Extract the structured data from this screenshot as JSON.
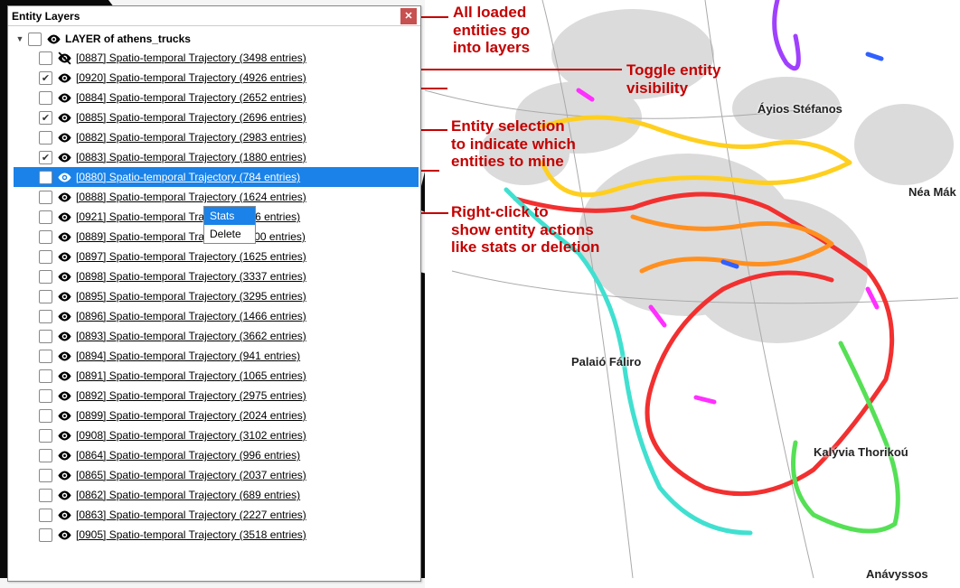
{
  "panel": {
    "title": "Entity Layers",
    "layer_label": "LAYER of athens_trucks",
    "context_menu": {
      "stats": "Stats",
      "delete": "Delete"
    },
    "entities": [
      {
        "id": "0887",
        "count": 3498,
        "checked": false,
        "visible": false
      },
      {
        "id": "0920",
        "count": 4926,
        "checked": true,
        "visible": true
      },
      {
        "id": "0884",
        "count": 2652,
        "checked": false,
        "visible": true
      },
      {
        "id": "0885",
        "count": 2696,
        "checked": true,
        "visible": true
      },
      {
        "id": "0882",
        "count": 2983,
        "checked": false,
        "visible": true
      },
      {
        "id": "0883",
        "count": 1880,
        "checked": true,
        "visible": true
      },
      {
        "id": "0880",
        "count": 784,
        "checked": false,
        "visible": true,
        "selected": true
      },
      {
        "id": "0888",
        "count": 1624,
        "checked": false,
        "visible": true
      },
      {
        "id": "0921",
        "count": 576,
        "checked": false,
        "visible": true
      },
      {
        "id": "0889",
        "count": 1100,
        "checked": false,
        "visible": true
      },
      {
        "id": "0897",
        "count": 1625,
        "checked": false,
        "visible": true
      },
      {
        "id": "0898",
        "count": 3337,
        "checked": false,
        "visible": true
      },
      {
        "id": "0895",
        "count": 3295,
        "checked": false,
        "visible": true
      },
      {
        "id": "0896",
        "count": 1466,
        "checked": false,
        "visible": true
      },
      {
        "id": "0893",
        "count": 3662,
        "checked": false,
        "visible": true
      },
      {
        "id": "0894",
        "count": 941,
        "checked": false,
        "visible": true
      },
      {
        "id": "0891",
        "count": 1065,
        "checked": false,
        "visible": true
      },
      {
        "id": "0892",
        "count": 2975,
        "checked": false,
        "visible": true
      },
      {
        "id": "0899",
        "count": 2024,
        "checked": false,
        "visible": true
      },
      {
        "id": "0908",
        "count": 3102,
        "checked": false,
        "visible": true
      },
      {
        "id": "0864",
        "count": 996,
        "checked": false,
        "visible": true
      },
      {
        "id": "0865",
        "count": 2037,
        "checked": false,
        "visible": true
      },
      {
        "id": "0862",
        "count": 689,
        "checked": false,
        "visible": true
      },
      {
        "id": "0863",
        "count": 2227,
        "checked": false,
        "visible": true
      },
      {
        "id": "0905",
        "count": 3518,
        "checked": false,
        "visible": true
      }
    ]
  },
  "annotations": {
    "a1": "All loaded\nentities go\ninto layers",
    "a2": "Toggle entity\nvisibility",
    "a3": "Entity selection\nto indicate which\nentities to mine",
    "a4": "Right-click to\nshow entity actions\nlike stats or deletion"
  },
  "map_labels": {
    "ayios_stefanos": "Áyios Stéfanos",
    "nea_maki": "Néa Mák",
    "palaio_faliro": "Palaió Fáliro",
    "kalyvia": "Kalývia Thorikoú",
    "anavyssos": "Anávyssos"
  },
  "colors": {
    "selection": "#1a82e8",
    "annotation": "#c40000",
    "close": "#c75050"
  }
}
